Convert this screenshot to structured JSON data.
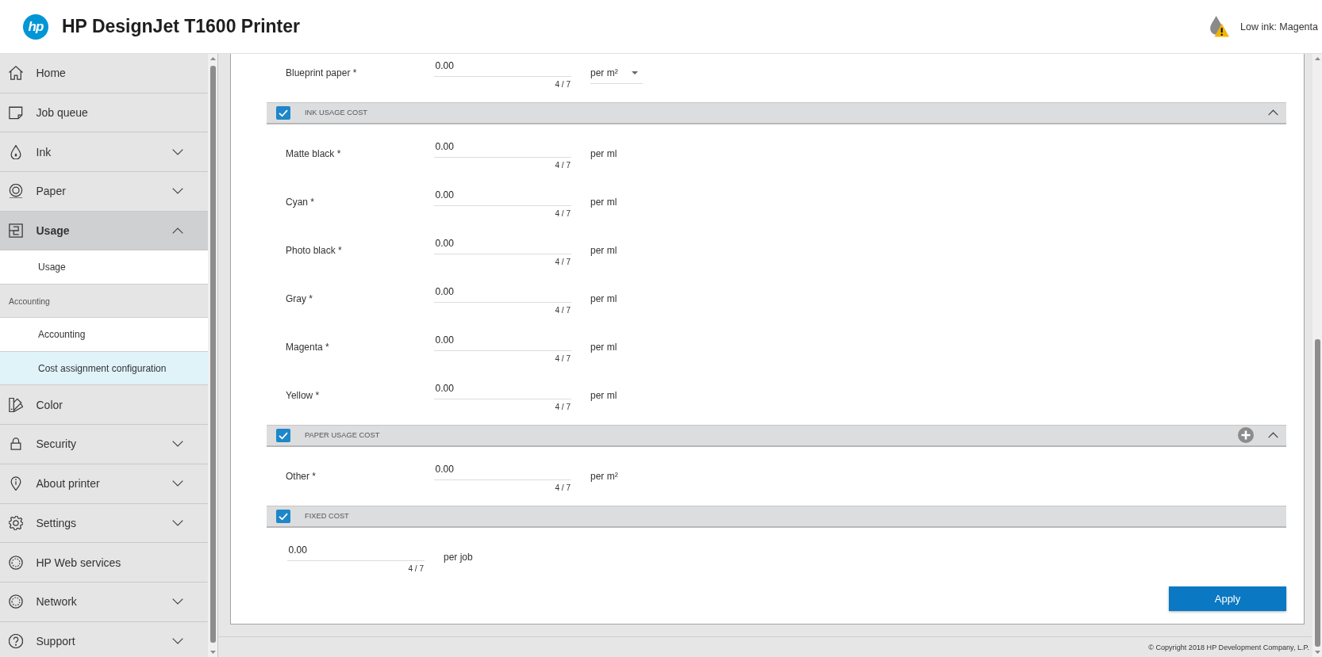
{
  "header": {
    "logo_text": "hp",
    "title": "HP DesignJet T1600 Printer",
    "status": "Low ink: Magenta"
  },
  "sidebar": {
    "items": [
      {
        "label": "Home",
        "kind": "link",
        "selected": false
      },
      {
        "label": "Job queue",
        "kind": "link",
        "selected": false
      },
      {
        "label": "Ink",
        "kind": "group",
        "expanded": false,
        "selected": false
      },
      {
        "label": "Paper",
        "kind": "group",
        "expanded": false,
        "selected": false
      },
      {
        "label": "Usage",
        "kind": "group",
        "expanded": true,
        "selected": true,
        "children": [
          {
            "label": "Usage",
            "kind": "link",
            "selected": false
          },
          {
            "label": "Accounting",
            "kind": "heading"
          },
          {
            "label": "Accounting",
            "kind": "link",
            "selected": false
          },
          {
            "label": "Cost assignment configuration",
            "kind": "link",
            "selected": true
          }
        ]
      },
      {
        "label": "Color",
        "kind": "link",
        "selected": false
      },
      {
        "label": "Security",
        "kind": "group",
        "expanded": false,
        "selected": false
      },
      {
        "label": "About printer",
        "kind": "group",
        "expanded": false,
        "selected": false
      },
      {
        "label": "Settings",
        "kind": "group",
        "expanded": false,
        "selected": false
      },
      {
        "label": "HP Web services",
        "kind": "link",
        "selected": false
      },
      {
        "label": "Network",
        "kind": "group",
        "expanded": false,
        "selected": false
      },
      {
        "label": "Support",
        "kind": "group",
        "expanded": false,
        "selected": false
      }
    ]
  },
  "form": {
    "sections": [
      {
        "rows": [
          {
            "kind": "select",
            "label": "Blueprint paper *",
            "value": "0.00",
            "counter": "4 / 7",
            "unit": "per m²"
          }
        ]
      },
      {
        "title": "INK USAGE COST",
        "checked": true,
        "expanded": true,
        "rows": [
          {
            "kind": "text",
            "label": "Matte black *",
            "value": "0.00",
            "counter": "4 / 7",
            "unit": "per ml"
          },
          {
            "kind": "text",
            "label": "Cyan *",
            "value": "0.00",
            "counter": "4 / 7",
            "unit": "per ml"
          },
          {
            "kind": "text",
            "label": "Photo black *",
            "value": "0.00",
            "counter": "4 / 7",
            "unit": "per ml"
          },
          {
            "kind": "text",
            "label": "Gray *",
            "value": "0.00",
            "counter": "4 / 7",
            "unit": "per ml"
          },
          {
            "kind": "text",
            "label": "Magenta *",
            "value": "0.00",
            "counter": "4 / 7",
            "unit": "per ml"
          },
          {
            "kind": "text",
            "label": "Yellow *",
            "value": "0.00",
            "counter": "4 / 7",
            "unit": "per ml"
          }
        ]
      },
      {
        "title": "PAPER USAGE COST",
        "checked": true,
        "expanded": true,
        "add_button": true,
        "rows": [
          {
            "kind": "text",
            "label": "Other *",
            "value": "0.00",
            "counter": "4 / 7",
            "unit": "per m²"
          }
        ]
      },
      {
        "title": "FIXED COST",
        "checked": true,
        "rows": [
          {
            "kind": "text",
            "value": "0.00",
            "counter": "4 / 7",
            "unit": "per job"
          }
        ]
      }
    ],
    "apply_button": "Apply"
  },
  "footer": {
    "copyright": "© Copyright 2018 HP Development Company, L.P."
  }
}
